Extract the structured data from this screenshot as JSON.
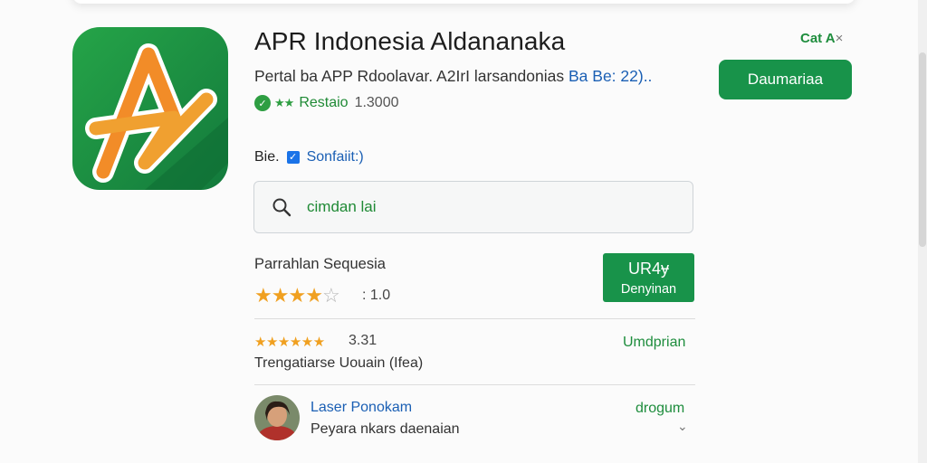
{
  "app": {
    "title": "APR Indonesia Aldananaka",
    "subtitle_prefix": "Pertal ba APP Rdoolavar. A2IrI larsandonias",
    "subtitle_link": "Ba Be: 22)..",
    "rating_label": "Restaio",
    "rating_count": "1.3000",
    "icon": "app-logo-a-icon"
  },
  "header": {
    "cta_link": "Cat A",
    "cta_close": "×",
    "primary_button": "Daumariaa"
  },
  "filter": {
    "prefix": "Bie.",
    "checkbox_label": "Sonfaiit:)",
    "checked": true
  },
  "search": {
    "value": "cimdan lai",
    "icon": "search-icon"
  },
  "rating_section": {
    "title": "Parrahlan Sequesia",
    "stars_filled": 4,
    "stars_total": 5,
    "value": "1.0",
    "card_line1": "UR4ɏ",
    "card_line2": "Denyinan"
  },
  "review": {
    "stars": "★★★★★★",
    "score": "3.31",
    "text": "Trengatiarse Uouain (Ifea)",
    "action": "Umdprian"
  },
  "user": {
    "name": "Laser Ponokam",
    "description": "Peyara nkars daenaian",
    "action": "drogum",
    "chevron": "⌄"
  },
  "colors": {
    "primary_green": "#18934a",
    "link_blue": "#1a5fb4",
    "star_orange": "#f0a020"
  }
}
